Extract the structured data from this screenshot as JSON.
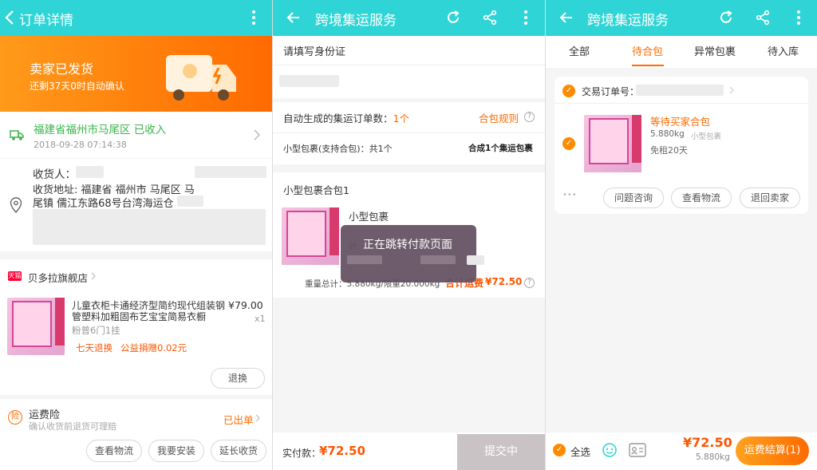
{
  "p1": {
    "title": "订单详情",
    "banner_status": "卖家已发货",
    "banner_sub": "还剩37天0时自动确认",
    "logistics_status": "福建省福州市马尾区 已收入",
    "logistics_time": "2018-09-28 07:14:38",
    "receiver_label": "收货人：",
    "address_line1": "收货地址: 福建省 福州市 马尾区 马",
    "address_line2": "尾镇 儒江东路68号台湾海运仓",
    "shop_badge": "天猫",
    "shop_name": "贝多拉旗舰店",
    "product_title_1": "儿童衣柜卡通经济型简约现代组装钢",
    "product_title_2": "管塑料加粗固布艺宝宝简易衣橱",
    "product_price": "¥79.00",
    "product_qty": "x1",
    "product_sku": "粉普6门1挂",
    "tag_return": "七天退换",
    "tag_charity": "公益捐赠0.02元",
    "refund_btn": "退换",
    "insurance_icon": "险",
    "insurance_title": "运费险",
    "insurance_sub": "确认收货前退货可理赔",
    "insurance_status": "已出单",
    "btn_logistics": "查看物流",
    "btn_install": "我要安装",
    "btn_extend": "延长收货",
    "colors": {
      "bar": "#2fd5d6",
      "banner_start": "#ff9a1a",
      "banner_end": "#ff6a00",
      "accent": "#ff5500",
      "green": "#3ab54a"
    }
  },
  "p2": {
    "title": "跨境集运服务",
    "id_prompt": "请填写身份证",
    "orders_label": "自动生成的集运订单数：",
    "orders_count": "1个",
    "rule_link": "合包规则",
    "help_icon": "?",
    "small_pkg_label": "小型包裹(支持合包)：共1个",
    "small_pkg_right": "合成1个集运包裹",
    "merge_title": "小型包裹合包1",
    "pkg_name": "小型包裹",
    "pkg_calc_partial": "计",
    "weight_text": "重量总计：5.880kg/限重20.000kg",
    "total_label": "合计运费",
    "total_value": "¥72.50",
    "toast": "正在跳转付款页面",
    "pay_label": "实付款：",
    "pay_value": "¥72.50",
    "submit_btn": "提交中"
  },
  "p3": {
    "title": "跨境集运服务",
    "tabs": [
      "全部",
      "待合包",
      "异常包裹",
      "待入库"
    ],
    "active_tab": 1,
    "order_no_label": "交易订单号：",
    "item_status": "等待买家合包",
    "item_weight": "5.880kg",
    "item_type": "小型包裹",
    "item_rent": "免租20天",
    "more_dots": "•••",
    "btn_consult": "问题咨询",
    "btn_logistics": "查看物流",
    "btn_return": "退回卖家",
    "select_all": "全选",
    "total_price": "¥72.50",
    "total_weight": "5.880kg",
    "settle_btn": "运费结算(1)"
  }
}
